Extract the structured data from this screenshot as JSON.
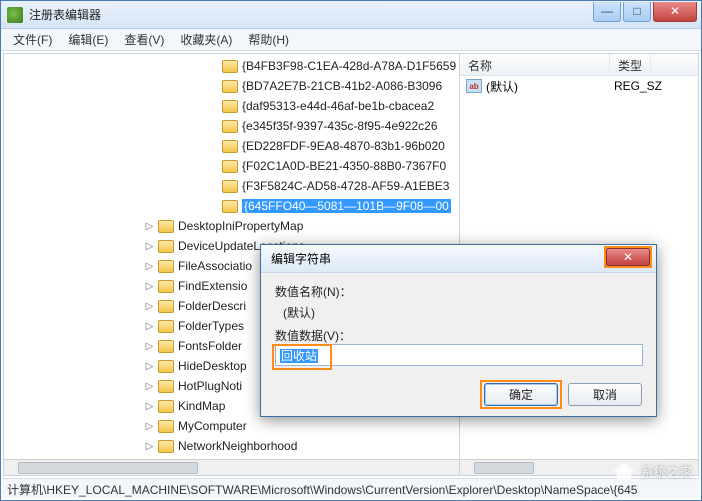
{
  "window": {
    "title": "注册表编辑器"
  },
  "menu": {
    "file": "文件(F)",
    "edit": "编辑(E)",
    "view": "查看(V)",
    "fav": "收藏夹(A)",
    "help": "帮助(H)"
  },
  "tree": {
    "guid_keys": [
      "{B4FB3F98-C1EA-428d-A78A-D1F5659",
      "{BD7A2E7B-21CB-41b2-A086-B3096",
      "{daf95313-e44d-46af-be1b-cbacea2",
      "{e345f35f-9397-435c-8f95-4e922c26",
      "{ED228FDF-9EA8-4870-83b1-96b020",
      "{F02C1A0D-BE21-4350-88B0-7367F0",
      "{F3F5824C-AD58-4728-AF59-A1EBE3",
      "{645FFO40—5081—101B—9F08—00"
    ],
    "named_keys": [
      "DesktopIniPropertyMap",
      "DeviceUpdateLocations",
      "FileAssociatio",
      "FindExtensio",
      "FolderDescri",
      "FolderTypes",
      "FontsFolder",
      "HideDesktop",
      "HotPlugNoti",
      "KindMap",
      "MyComputer",
      "NetworkNeighborhood"
    ]
  },
  "list": {
    "col_name": "名称",
    "col_type": "类型",
    "default_label": "(默认)",
    "default_type": "REG_SZ"
  },
  "dialog": {
    "title": "编辑字符串",
    "name_label": "数值名称(N)：",
    "name_value": "(默认)",
    "data_label": "数值数据(V)：",
    "data_value": "回收站",
    "ok": "确定",
    "cancel": "取消"
  },
  "status": {
    "path": "计算机\\HKEY_LOCAL_MACHINE\\SOFTWARE\\Microsoft\\Windows\\CurrentVersion\\Explorer\\Desktop\\NameSpace\\{645"
  },
  "watermark": {
    "text": "系统之家"
  }
}
